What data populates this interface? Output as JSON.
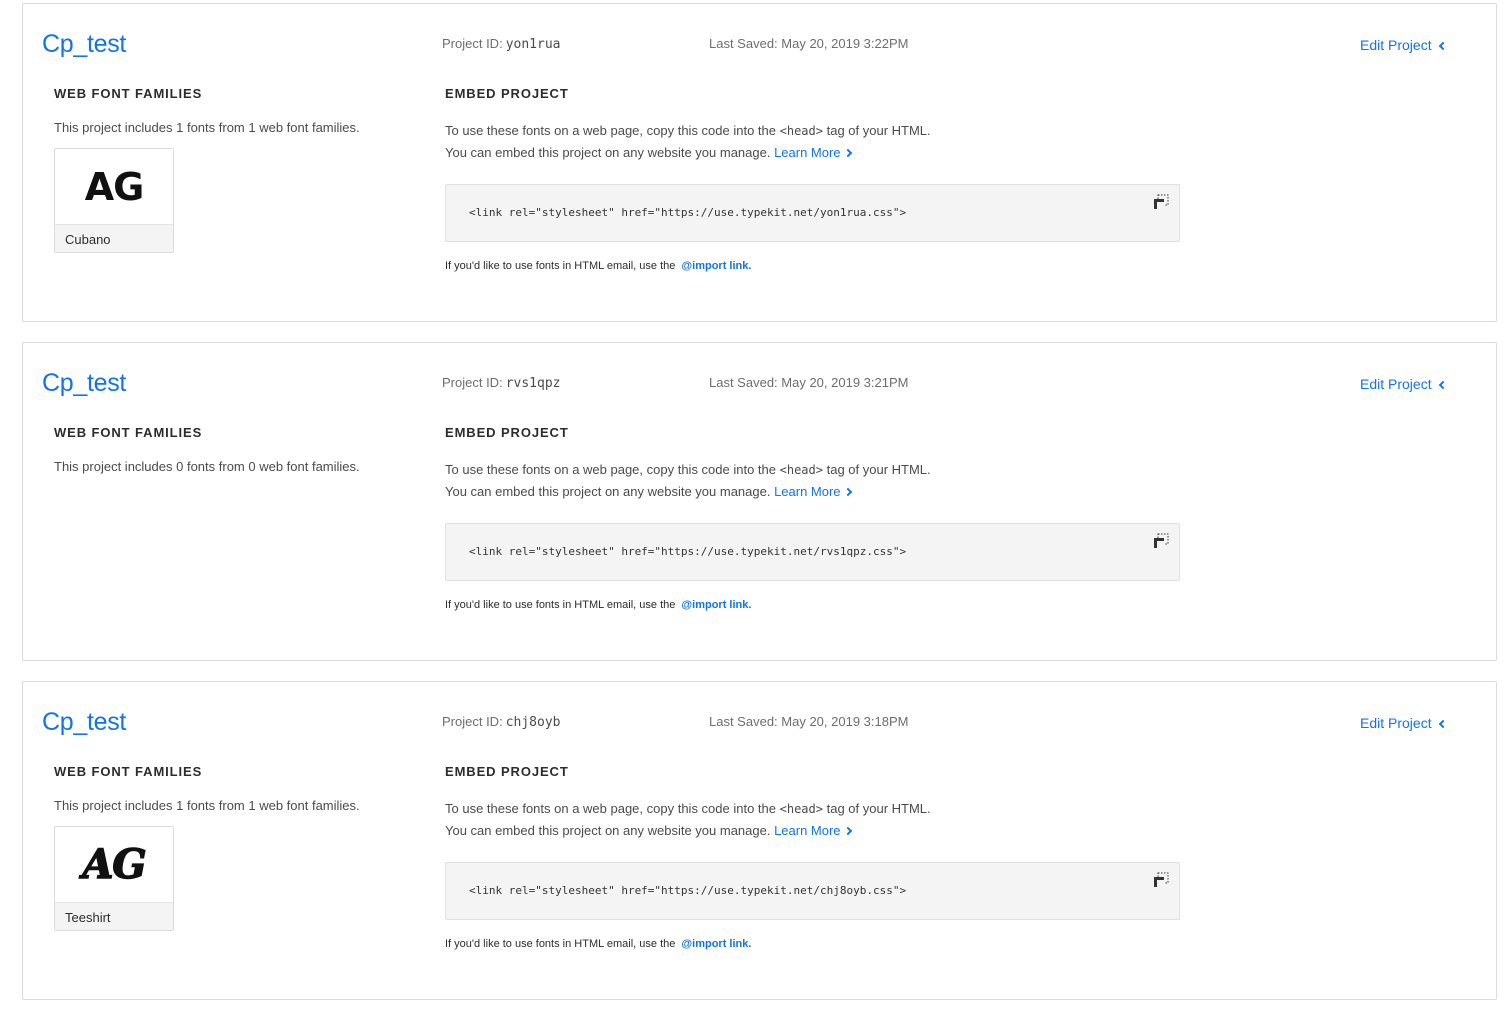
{
  "labels": {
    "project_id": "Project ID:",
    "last_saved_prefix": "Last Saved:",
    "edit_project": "Edit Project",
    "web_font_families": "WEB FONT FAMILIES",
    "embed_project": "EMBED PROJECT",
    "embed_line1_before": "To use these fonts on a web page, copy this code into the ",
    "embed_head_tag": "<head>",
    "embed_line1_after": " tag of your HTML.",
    "embed_line2": "You can embed this project on any website you manage. ",
    "learn_more": "Learn More",
    "import_note": "If you'd like to use fonts in HTML email, use the",
    "import_link": "@import link."
  },
  "projects": [
    {
      "name": "Cp_test",
      "id": "yon1rua",
      "last_saved": "May 20, 2019 3:22PM",
      "families_desc": "This project includes 1 fonts from 1 web font families.",
      "font": {
        "sample": "AG",
        "name": "Cubano",
        "style": "block"
      },
      "embed_code": "<link rel=\"stylesheet\" href=\"https://use.typekit.net/yon1rua.css\">"
    },
    {
      "name": "Cp_test",
      "id": "rvs1qpz",
      "last_saved": "May 20, 2019 3:21PM",
      "families_desc": "This project includes 0 fonts from 0 web font families.",
      "font": null,
      "embed_code": "<link rel=\"stylesheet\" href=\"https://use.typekit.net/rvs1qpz.css\">"
    },
    {
      "name": "Cp_test",
      "id": "chj8oyb",
      "last_saved": "May 20, 2019 3:18PM",
      "families_desc": "This project includes 1 fonts from 1 web font families.",
      "font": {
        "sample": "AG",
        "name": "Teeshirt",
        "style": "rounded"
      },
      "embed_code": "<link rel=\"stylesheet\" href=\"https://use.typekit.net/chj8oyb.css\">"
    }
  ],
  "colors": {
    "accent": "#1473e6",
    "code_bg": "#f4f4f4",
    "border": "#dcdcdc"
  }
}
